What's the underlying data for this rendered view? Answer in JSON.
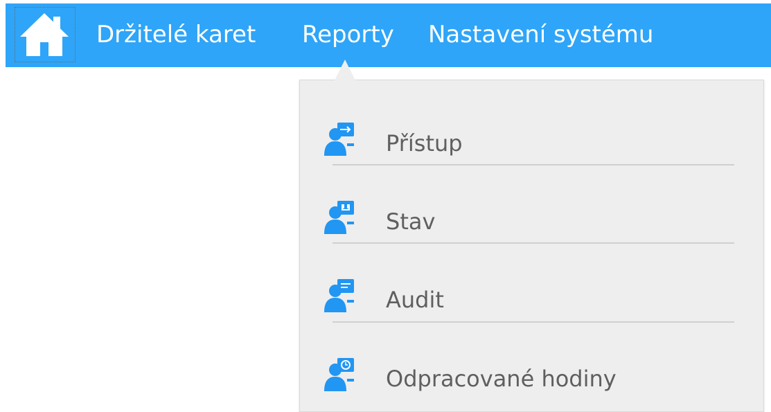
{
  "navbar": {
    "background_color": "#2ea5f8",
    "home_icon": "home-icon",
    "items": [
      {
        "label": "Držitelé karet"
      },
      {
        "label": "Reporty"
      },
      {
        "label": "Nastavení systému"
      }
    ]
  },
  "reports_menu": {
    "background_color": "#eeeeee",
    "items": [
      {
        "label": "Přístup",
        "icon": "report-access-icon"
      },
      {
        "label": "Stav",
        "icon": "report-status-icon"
      },
      {
        "label": "Audit",
        "icon": "report-audit-icon"
      },
      {
        "label": "Odpracované hodiny",
        "icon": "report-hours-icon"
      }
    ]
  }
}
